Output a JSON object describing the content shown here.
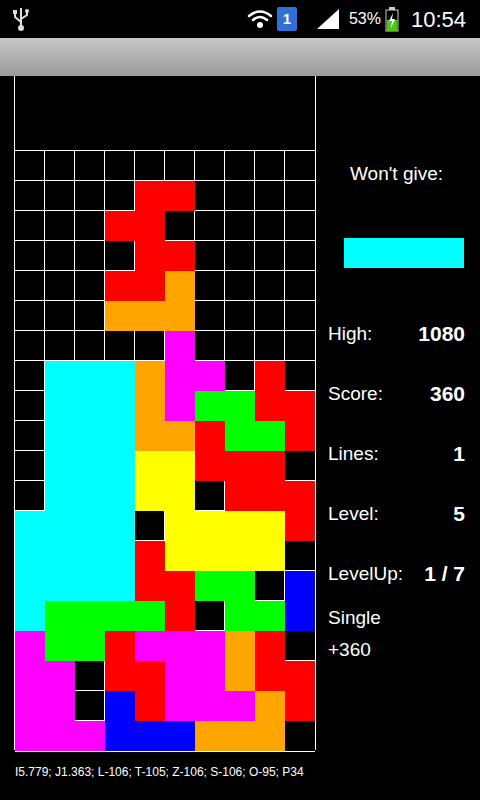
{
  "status_bar": {
    "notification_badge": "1",
    "battery": "53%",
    "battery_level": 0.53,
    "time": "10:54"
  },
  "board": {
    "rows": [
      [
        null,
        null,
        null,
        null,
        null,
        null,
        null,
        null,
        null,
        null
      ],
      [
        null,
        null,
        null,
        null,
        "#ff0000",
        "#ff0000",
        null,
        null,
        null,
        null
      ],
      [
        null,
        null,
        null,
        "#ff0000",
        "#ff0000",
        null,
        null,
        null,
        null,
        null
      ],
      [
        null,
        null,
        null,
        null,
        "#ff0000",
        "#ff0000",
        null,
        null,
        null,
        null
      ],
      [
        null,
        null,
        null,
        "#ff0000",
        "#ff0000",
        "#ffa500",
        null,
        null,
        null,
        null
      ],
      [
        null,
        null,
        null,
        "#ffa500",
        "#ffa500",
        "#ffa500",
        null,
        null,
        null,
        null
      ],
      [
        null,
        null,
        null,
        null,
        null,
        "#ff00ff",
        null,
        null,
        null,
        null
      ],
      [
        null,
        "#00ffff",
        "#00ffff",
        "#00ffff",
        "#ffa500",
        "#ff00ff",
        "#ff00ff",
        null,
        "#ff0000",
        null
      ],
      [
        null,
        "#00ffff",
        "#00ffff",
        "#00ffff",
        "#ffa500",
        "#ff00ff",
        "#00ff00",
        "#00ff00",
        "#ff0000",
        "#ff0000"
      ],
      [
        null,
        "#00ffff",
        "#00ffff",
        "#00ffff",
        "#ffa500",
        "#ffa500",
        "#ff0000",
        "#00ff00",
        "#00ff00",
        "#ff0000"
      ],
      [
        null,
        "#00ffff",
        "#00ffff",
        "#00ffff",
        "#ffff00",
        "#ffff00",
        "#ff0000",
        "#ff0000",
        "#ff0000",
        null
      ],
      [
        null,
        "#00ffff",
        "#00ffff",
        "#00ffff",
        "#ffff00",
        "#ffff00",
        null,
        "#ff0000",
        "#ff0000",
        "#ff0000"
      ],
      [
        "#00ffff",
        "#00ffff",
        "#00ffff",
        "#00ffff",
        null,
        "#ffff00",
        "#ffff00",
        "#ffff00",
        "#ffff00",
        "#ff0000"
      ],
      [
        "#00ffff",
        "#00ffff",
        "#00ffff",
        "#00ffff",
        "#ff0000",
        "#ffff00",
        "#ffff00",
        "#ffff00",
        "#ffff00",
        null
      ],
      [
        "#00ffff",
        "#00ffff",
        "#00ffff",
        "#00ffff",
        "#ff0000",
        "#ff0000",
        "#00ff00",
        "#00ff00",
        null,
        "#0000ff"
      ],
      [
        "#00ffff",
        "#00ff00",
        "#00ff00",
        "#00ff00",
        "#00ff00",
        "#ff0000",
        null,
        "#00ff00",
        "#00ff00",
        "#0000ff"
      ],
      [
        "#ff00ff",
        "#00ff00",
        "#00ff00",
        "#ff0000",
        "#ff00ff",
        "#ff00ff",
        "#ff00ff",
        "#ffa500",
        "#ff0000",
        null
      ],
      [
        "#ff00ff",
        "#ff00ff",
        null,
        "#ff0000",
        "#ff0000",
        "#ff00ff",
        "#ff00ff",
        "#ffa500",
        "#ff0000",
        "#ff0000"
      ],
      [
        "#ff00ff",
        "#ff00ff",
        null,
        "#0000ff",
        "#ff0000",
        "#ff00ff",
        "#ff00ff",
        "#ff00ff",
        "#ffa500",
        "#ff0000"
      ],
      [
        "#ff00ff",
        "#ff00ff",
        "#ff00ff",
        "#0000ff",
        "#0000ff",
        "#0000ff",
        "#ffa500",
        "#ffa500",
        "#ffa500",
        null
      ]
    ]
  },
  "wont_give": {
    "label": "Won't give:",
    "piece": [
      "#00ffff",
      "#00ffff",
      "#00ffff",
      "#00ffff"
    ]
  },
  "stats": [
    {
      "label": "High:",
      "value": "1080"
    },
    {
      "label": "Score:",
      "value": "360"
    },
    {
      "label": "Lines:",
      "value": "1"
    },
    {
      "label": "Level:",
      "value": "5"
    },
    {
      "label": "LevelUp:",
      "value": "1 / 7"
    }
  ],
  "message": {
    "title": "Single",
    "points": "+360"
  },
  "footer": "I5.779; J1.363; L-106; T-105; Z-106; S-106; O-95; P34"
}
